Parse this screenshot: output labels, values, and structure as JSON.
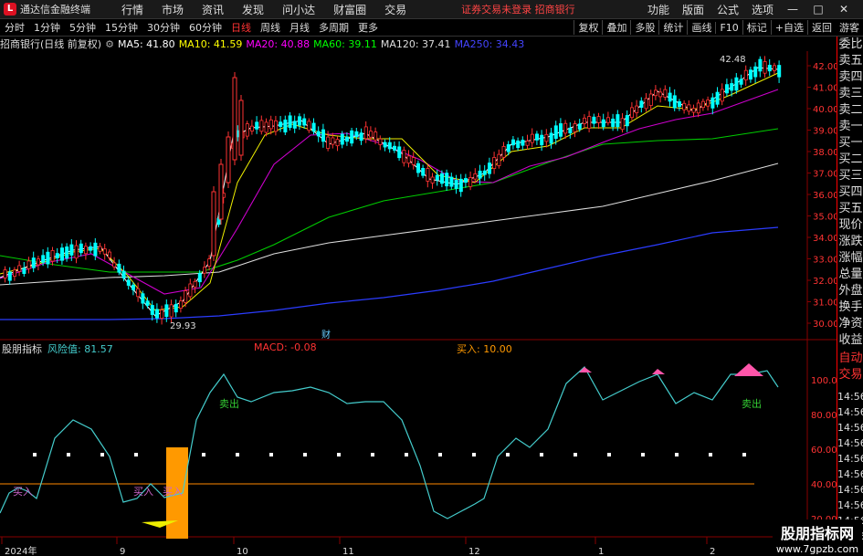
{
  "menubar": {
    "logo": "L",
    "app_title": "通达信金融终端",
    "items": [
      "行情",
      "市场",
      "资讯",
      "发现",
      "问小达",
      "财富圈",
      "交易"
    ],
    "notice": "证券交易未登录  招商银行",
    "right_items": [
      "功能",
      "版面",
      "公式",
      "选项"
    ],
    "guest": "游客"
  },
  "periodbar": {
    "tabs": [
      "分时",
      "1分钟",
      "5分钟",
      "15分钟",
      "30分钟",
      "60分钟",
      "日线",
      "周线",
      "月线",
      "多周期",
      "更多"
    ],
    "active_index": 6,
    "right_tabs": [
      "复权",
      "叠加",
      "多股",
      "统计",
      "画线",
      "F10",
      "标记",
      "+自选",
      "返回"
    ]
  },
  "chart_title": {
    "stock": "招商银行(日线 前复权)",
    "ma5": "MA5: 41.80",
    "ma10": "MA10: 41.59",
    "ma20": "MA20: 40.88",
    "ma60": "MA60: 39.11",
    "ma120": "MA120: 37.41",
    "ma250": "MA250: 34.43"
  },
  "colors": {
    "ma5": "#ffffff",
    "ma10": "#ffff00",
    "ma20": "#ff00ff",
    "ma60": "#00ff00",
    "ma120": "#dddddd",
    "ma250": "#4040ff",
    "up": "#ff3333",
    "down": "#00ffff"
  },
  "price_axis": [
    "42.00",
    "41.00",
    "40.00",
    "39.00",
    "38.00",
    "37.00",
    "36.00",
    "35.00",
    "34.00",
    "33.00",
    "32.00",
    "31.00",
    "30.00"
  ],
  "high_marker": "42.48",
  "low_marker": "29.93",
  "cai_marker": "财",
  "indicator_title": {
    "name": "股朋指标",
    "risk": "风险值: 81.57",
    "macd": "MACD: -0.08",
    "buy": "买入: 10.00"
  },
  "indicator_axis": [
    "100.00",
    "80.00",
    "60.00",
    "40.00",
    "20.00"
  ],
  "indicator_labels": {
    "sell1": "卖出",
    "sell2": "卖出",
    "buy1": "买入",
    "buy2": "买入",
    "buy3": "买入"
  },
  "time_axis": [
    "2024年",
    "9",
    "10",
    "11",
    "12",
    "1",
    "2"
  ],
  "right_panel_top": [
    "委比",
    "卖五",
    "卖四",
    "卖三",
    "卖二",
    "卖一",
    "买一",
    "买二",
    "买三",
    "买四",
    "买五",
    "现价",
    "涨跌",
    "涨幅",
    "总量",
    "外盘",
    "换手",
    "净资",
    "收益"
  ],
  "right_panel_bottom": [
    "自动",
    "交易"
  ],
  "time_stamps": [
    "14:56",
    "14:56",
    "14:56",
    "14:56",
    "14:56",
    "14:56",
    "14:56",
    "14:56",
    "14:56",
    "14:56"
  ],
  "watermark": {
    "line1": "股朋指标网",
    "line2": "www.7gpzb.com"
  }
}
